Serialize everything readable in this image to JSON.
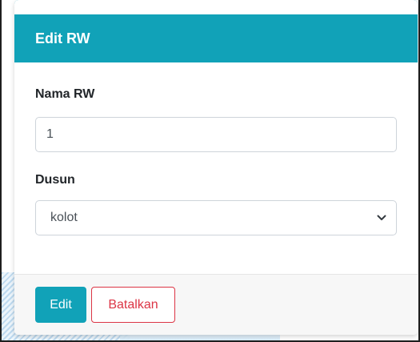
{
  "card": {
    "title": "Edit RW"
  },
  "form": {
    "nama_rw": {
      "label": "Nama RW",
      "value": "1"
    },
    "dusun": {
      "label": "Dusun",
      "selected": "kolot"
    }
  },
  "buttons": {
    "edit": "Edit",
    "cancel": "Batalkan"
  },
  "colors": {
    "header": "#11a2b8",
    "primary_button": "#11a2b8",
    "cancel_border": "#dc3545"
  },
  "icons": {
    "select": "chevron-down-icon"
  }
}
